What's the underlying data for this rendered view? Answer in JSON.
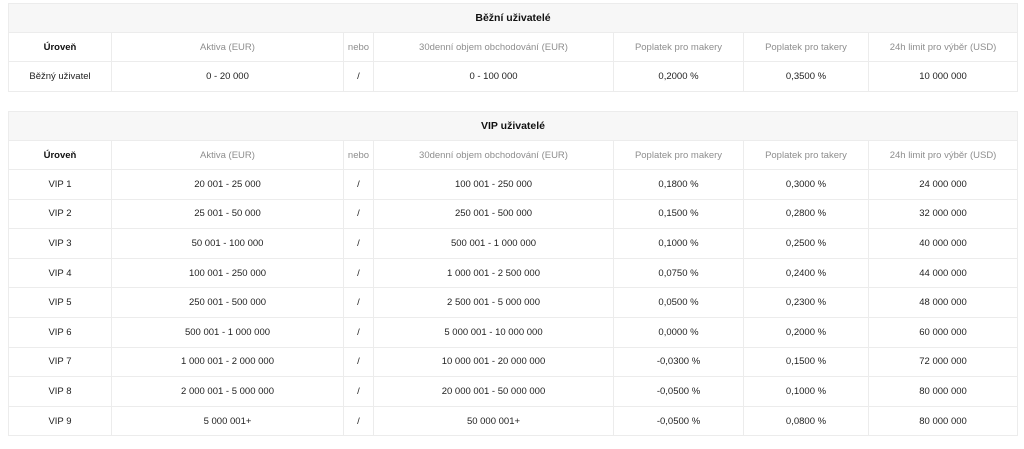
{
  "regular": {
    "title": "Běžní uživatelé",
    "headers": [
      "Úroveň",
      "Aktiva (EUR)",
      "nebo",
      "30denní objem obchodování (EUR)",
      "Poplatek pro makery",
      "Poplatek pro takery",
      "24h limit pro výběr (USD)"
    ],
    "rows": [
      [
        "Běžný uživatel",
        "0 - 20 000",
        "/",
        "0 - 100 000",
        "0,2000 %",
        "0,3500 %",
        "10 000 000"
      ]
    ]
  },
  "vip": {
    "title": "VIP uživatelé",
    "headers": [
      "Úroveň",
      "Aktiva (EUR)",
      "nebo",
      "30denní objem obchodování (EUR)",
      "Poplatek pro makery",
      "Poplatek pro takery",
      "24h limit pro výběr (USD)"
    ],
    "rows": [
      [
        "VIP 1",
        "20 001 - 25 000",
        "/",
        "100 001 - 250 000",
        "0,1800 %",
        "0,3000 %",
        "24 000 000"
      ],
      [
        "VIP 2",
        "25 001 - 50 000",
        "/",
        "250 001 - 500 000",
        "0,1500 %",
        "0,2800 %",
        "32 000 000"
      ],
      [
        "VIP 3",
        "50 001 - 100 000",
        "/",
        "500 001 - 1 000 000",
        "0,1000 %",
        "0,2500 %",
        "40 000 000"
      ],
      [
        "VIP 4",
        "100 001 - 250 000",
        "/",
        "1 000 001 - 2 500 000",
        "0,0750 %",
        "0,2400 %",
        "44 000 000"
      ],
      [
        "VIP 5",
        "250 001 - 500 000",
        "/",
        "2 500 001 - 5 000 000",
        "0,0500 %",
        "0,2300 %",
        "48 000 000"
      ],
      [
        "VIP 6",
        "500 001 - 1 000 000",
        "/",
        "5 000 001 - 10 000 000",
        "0,0000 %",
        "0,2000 %",
        "60 000 000"
      ],
      [
        "VIP 7",
        "1 000 001 - 2 000 000",
        "/",
        "10 000 001 - 20 000 000",
        "-0,0300 %",
        "0,1500 %",
        "72 000 000"
      ],
      [
        "VIP 8",
        "2 000 001 - 5 000 000",
        "/",
        "20 000 001 - 50 000 000",
        "-0,0500 %",
        "0,1000 %",
        "80 000 000"
      ],
      [
        "VIP 9",
        "5 000 001+",
        "/",
        "50 000 001+",
        "-0,0500 %",
        "0,0800 %",
        "80 000 000"
      ]
    ]
  }
}
